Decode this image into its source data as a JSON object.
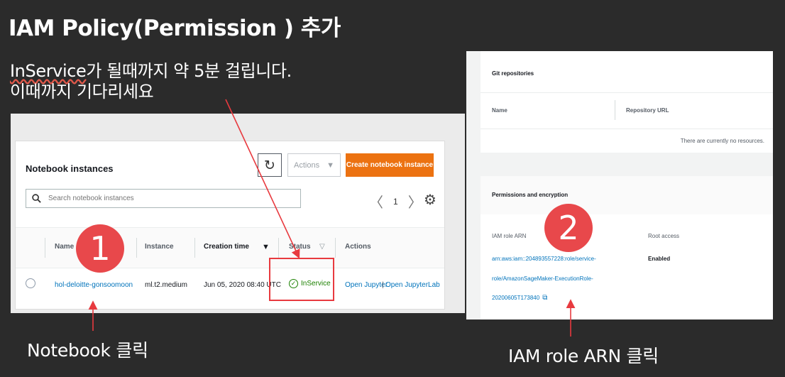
{
  "slide": {
    "title": "IAM Policy(Permission ) 추가",
    "note_line1_prefix": "InService",
    "note_line1_rest": "가 될때까지 약 5분 걸립니다.",
    "note_line2": "이때까지 기다리세요",
    "caption_left": "Notebook 클릭",
    "caption_right": "IAM role ARN 클릭",
    "step1": "1",
    "step2": "2"
  },
  "notebook_panel": {
    "title": "Notebook instances",
    "refresh_icon": "refresh-icon",
    "actions_label": "Actions",
    "create_label": "Create notebook instance",
    "search_placeholder": "Search notebook instances",
    "page_number": "1",
    "columns": [
      "Name",
      "Instance",
      "Creation time",
      "Status",
      "Actions"
    ],
    "row": {
      "name": "hol-deloitte-gonsoomoon",
      "instance": "ml.t2.medium",
      "creation_time": "Jun 05, 2020 08:40 UTC",
      "status": "InService",
      "action_jupyter": "Open Jupyter",
      "separator": "|",
      "action_jupyterlab": "Open JupyterLab"
    }
  },
  "details_panel": {
    "git_title": "Git repositories",
    "git_col_name": "Name",
    "git_col_url": "Repository URL",
    "git_empty": "There are currently no resources.",
    "perm_title": "Permissions and encryption",
    "role_label": "IAM role ARN",
    "role_arn_line1": "arn:aws:iam::204893557228:role/service-",
    "role_arn_line2": "role/AmazonSageMaker-ExecutionRole-",
    "role_arn_line3": "20200605T173840",
    "root_label": "Root access",
    "root_value": "Enabled"
  },
  "colors": {
    "background": "#2b2b2b",
    "accent_red": "#e8484b",
    "aws_orange": "#ec7211",
    "link_blue": "#0073bb",
    "success_green": "#1d8102"
  }
}
